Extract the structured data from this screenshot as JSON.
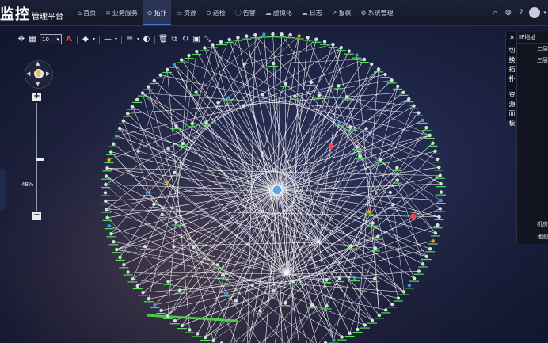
{
  "brand": {
    "main": "监控",
    "sub": "管理平台"
  },
  "nav": [
    {
      "label": "首页",
      "icon": "home-icon",
      "glyph": "⌂",
      "active": false
    },
    {
      "label": "业务服务",
      "icon": "layers-icon",
      "glyph": "≋",
      "active": false
    },
    {
      "label": "拓扑",
      "icon": "globe-icon",
      "glyph": "⊕",
      "active": true
    },
    {
      "label": "资源",
      "icon": "monitor-icon",
      "glyph": "▭",
      "active": false
    },
    {
      "label": "巡检",
      "icon": "inspect-icon",
      "glyph": "⊖",
      "active": false
    },
    {
      "label": "告警",
      "icon": "alarm-icon",
      "glyph": "ⓘ",
      "active": false
    },
    {
      "label": "虚拟化",
      "icon": "cloud-icon",
      "glyph": "☁",
      "active": false
    },
    {
      "label": "日志",
      "icon": "log-cloud-icon",
      "glyph": "☁",
      "active": false
    },
    {
      "label": "报表",
      "icon": "report-icon",
      "glyph": "↗",
      "active": false
    },
    {
      "label": "系统管理",
      "icon": "settings-icon",
      "glyph": "⚙",
      "active": false
    }
  ],
  "topRight": {
    "search_icon": "search-icon",
    "globe_icon": "globe-icon",
    "help_icon": "help-icon"
  },
  "toolbar": {
    "font_size": "10"
  },
  "zoom": {
    "level": "48%",
    "fraction": 0.48
  },
  "sidePanel": {
    "tabs": [
      "切换拓扑",
      "资源面板"
    ],
    "header": "IP地址",
    "rows": [
      "二层",
      "三层"
    ],
    "footer": [
      "机房",
      "地图"
    ]
  },
  "colors": {
    "link": "#ffffff",
    "label": "#4fe34f",
    "accent": "#3f7ad1",
    "alert": "#e84b4b",
    "warn": "#f0a030",
    "node_blue": "#4a90e2"
  }
}
